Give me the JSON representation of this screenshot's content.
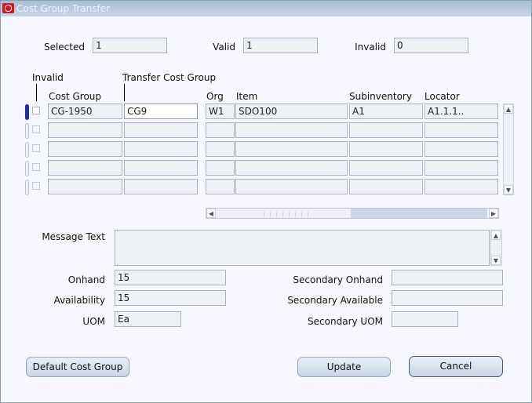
{
  "window": {
    "title": "Cost Group Transfer"
  },
  "summary": {
    "selected_label": "Selected",
    "selected_value": "1",
    "valid_label": "Valid",
    "valid_value": "1",
    "invalid_label": "Invalid",
    "invalid_value": "0"
  },
  "grid": {
    "headers": {
      "invalid": "Invalid",
      "transfer_cost_group": "Transfer Cost Group",
      "cost_group": "Cost Group",
      "org": "Org",
      "item": "Item",
      "subinventory": "Subinventory",
      "locator": "Locator"
    },
    "rows": [
      {
        "cost_group": "CG-1950",
        "transfer_cost_group": "CG9",
        "org": "W1",
        "item": "SDO100",
        "subinventory": "A1",
        "locator": "A1.1.1.."
      },
      {
        "cost_group": "",
        "transfer_cost_group": "",
        "org": "",
        "item": "",
        "subinventory": "",
        "locator": ""
      },
      {
        "cost_group": "",
        "transfer_cost_group": "",
        "org": "",
        "item": "",
        "subinventory": "",
        "locator": ""
      },
      {
        "cost_group": "",
        "transfer_cost_group": "",
        "org": "",
        "item": "",
        "subinventory": "",
        "locator": ""
      },
      {
        "cost_group": "",
        "transfer_cost_group": "",
        "org": "",
        "item": "",
        "subinventory": "",
        "locator": ""
      }
    ]
  },
  "details": {
    "message_text_label": "Message Text",
    "message_text_value": "",
    "onhand_label": "Onhand",
    "onhand_value": "15",
    "availability_label": "Availability",
    "availability_value": "15",
    "uom_label": "UOM",
    "uom_value": "Ea",
    "secondary_onhand_label": "Secondary Onhand",
    "secondary_onhand_value": "",
    "secondary_available_label": "Secondary Available",
    "secondary_available_value": "",
    "secondary_uom_label": "Secondary UOM",
    "secondary_uom_value": ""
  },
  "buttons": {
    "default_cost_group": "Default Cost Group",
    "update": "Update",
    "cancel": "Cancel"
  },
  "colors": {
    "title_bar": "#b4c6dc",
    "background": "#f7f7ff",
    "current_row": "#1f2fa0"
  }
}
